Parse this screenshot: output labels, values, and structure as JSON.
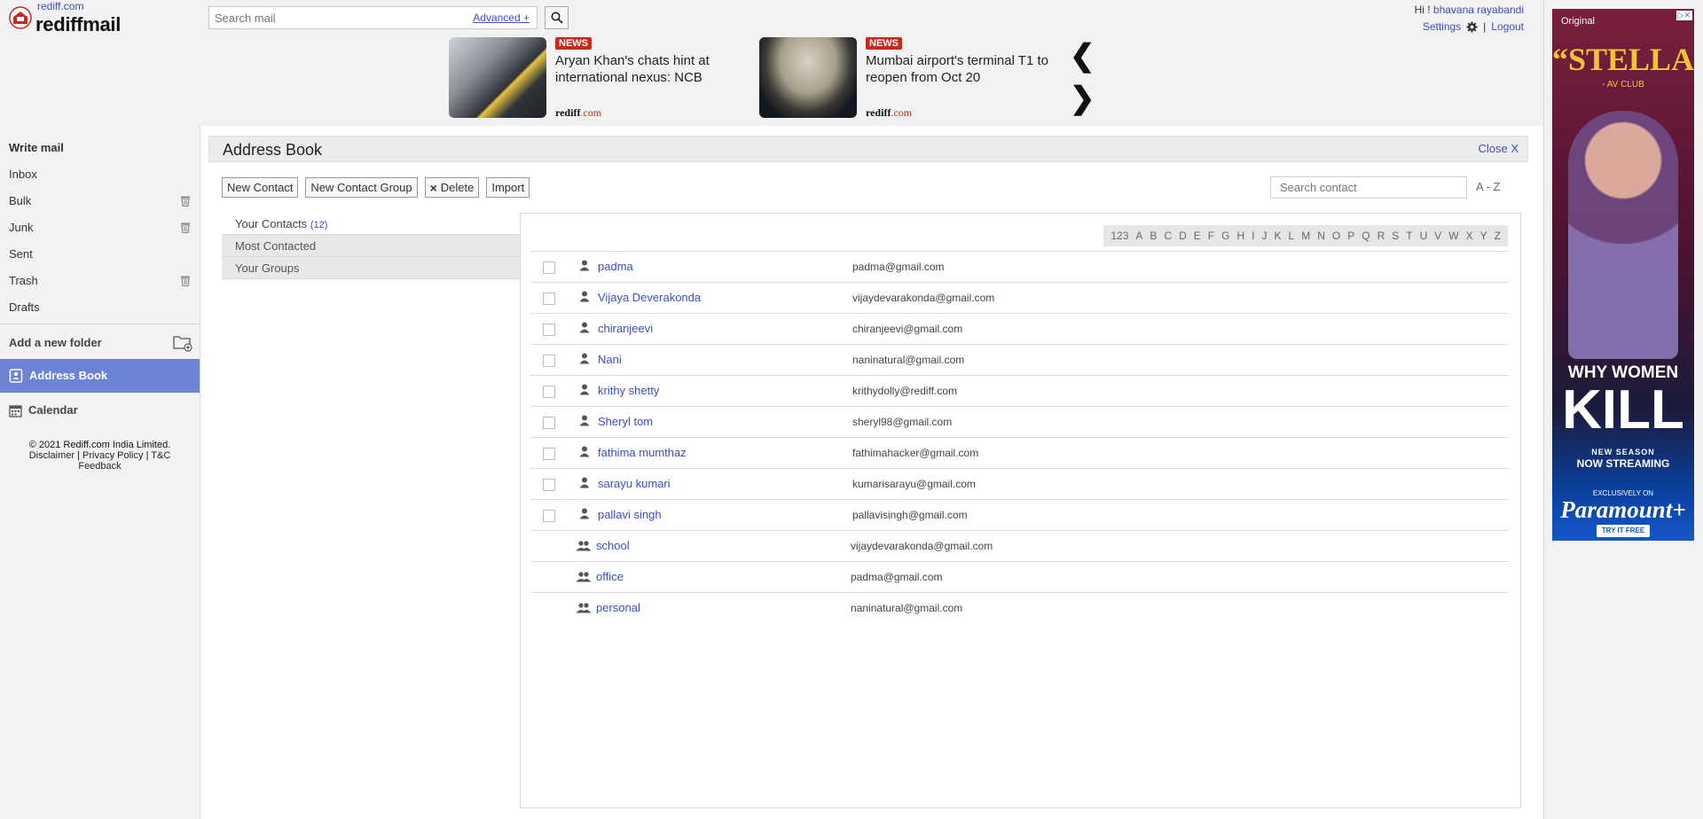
{
  "header": {
    "site_link": "rediff.com",
    "logo_text": "rediffmail",
    "search_placeholder": "Search mail",
    "advanced_label": "Advanced +",
    "greeting": "Hi !",
    "username": "bhavana rayabandi",
    "settings_label": "Settings",
    "logout_label": "Logout",
    "separator": "|"
  },
  "news": [
    {
      "badge": "NEWS",
      "headline": "Aryan Khan's chats hint at international nexus: NCB",
      "source_a": "rediff",
      "source_b": ".com"
    },
    {
      "badge": "NEWS",
      "headline": "Mumbai airport's terminal T1 to reopen from Oct 20",
      "source_a": "rediff",
      "source_b": ".com"
    }
  ],
  "news_nav": {
    "prev": "❮",
    "next": "❯"
  },
  "ad": {
    "badge": "Original",
    "title": "“STELLAR”",
    "subtitle": "- AV CLUB",
    "line1": "WHY WOMEN",
    "line2": "KILL",
    "line3": "NEW SEASON",
    "line4": "NOW STREAMING",
    "line5": "EXCLUSIVELY ON",
    "brand": "Paramount+",
    "cta": "TRY IT FREE"
  },
  "sidebar": {
    "items": [
      {
        "label": "Write mail"
      },
      {
        "label": "Inbox"
      },
      {
        "label": "Bulk"
      },
      {
        "label": "Junk"
      },
      {
        "label": "Sent"
      },
      {
        "label": "Trash"
      },
      {
        "label": "Drafts"
      }
    ],
    "add_folder": "Add a new folder",
    "address_book": "Address Book",
    "calendar": "Calendar",
    "footer": {
      "copyright": "© 2021 Rediff.com India Limited.",
      "disclaimer": "Disclaimer",
      "privacy": "Privacy Policy",
      "tc": "T&C",
      "feedback": "Feedback",
      "sep": "|"
    }
  },
  "address_book": {
    "title": "Address Book",
    "close_label": "Close X",
    "toolbar": {
      "new_contact": "New Contact",
      "new_group": "New Contact Group",
      "delete": "Delete",
      "import": "Import"
    },
    "search_placeholder": "Search contact",
    "sort_label": "A - Z",
    "groups": [
      {
        "label": "Your Contacts",
        "count": "(12)"
      },
      {
        "label": "Most Contacted"
      },
      {
        "label": "Your Groups"
      }
    ],
    "letters": [
      "123",
      "A",
      "B",
      "C",
      "D",
      "E",
      "F",
      "G",
      "H",
      "I",
      "J",
      "K",
      "L",
      "M",
      "N",
      "O",
      "P",
      "Q",
      "R",
      "S",
      "T",
      "U",
      "V",
      "W",
      "X",
      "Y",
      "Z"
    ],
    "contacts": [
      {
        "name": "padma",
        "email": "padma@gmail.com"
      },
      {
        "name": "Vijaya Deverakonda",
        "email": "vijaydevarakonda@gmail.com"
      },
      {
        "name": "chiranjeevi",
        "email": "chiranjeevi@gmail.com"
      },
      {
        "name": "Nani",
        "email": "naninatural@gmail.com"
      },
      {
        "name": "krithy shetty",
        "email": "krithydolly@rediff.com"
      },
      {
        "name": "Sheryl tom",
        "email": "sheryl98@gmail.com"
      },
      {
        "name": "fathima mumthaz",
        "email": "fathimahacker@gmail.com"
      },
      {
        "name": "sarayu kumari",
        "email": "kumarisarayu@gmail.com"
      },
      {
        "name": "pallavi singh",
        "email": "pallavisingh@gmail.com"
      }
    ],
    "contact_groups": [
      {
        "name": "school",
        "email": "vijaydevarakonda@gmail.com"
      },
      {
        "name": "office",
        "email": "padma@gmail.com"
      },
      {
        "name": "personal",
        "email": "naninatural@gmail.com"
      }
    ]
  },
  "colors": {
    "accent": "#6c84d4",
    "link": "#3a4fc2",
    "news_badge": "#c62a1f"
  }
}
